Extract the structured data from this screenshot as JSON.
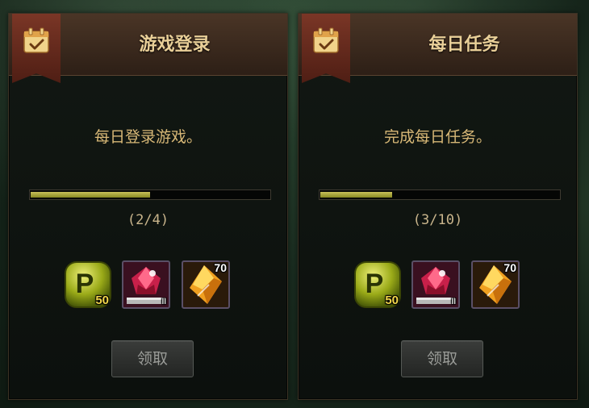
{
  "cards": [
    {
      "title": "游戏登录",
      "description": "每日登录游戏。",
      "progress_text": "(2/4)",
      "progress_fraction": 0.5,
      "rewards": [
        {
          "icon": "p-coin-icon",
          "amount": "50"
        },
        {
          "icon": "red-gem-box-icon",
          "tier": "II"
        },
        {
          "icon": "orange-crystal-icon",
          "count": "70"
        }
      ],
      "claim_label": "领取"
    },
    {
      "title": "每日任务",
      "description": "完成每日任务。",
      "progress_text": "(3/10)",
      "progress_fraction": 0.3,
      "rewards": [
        {
          "icon": "p-coin-icon",
          "amount": "50"
        },
        {
          "icon": "red-gem-box-icon",
          "tier": "II"
        },
        {
          "icon": "orange-crystal-icon",
          "count": "70"
        }
      ],
      "claim_label": "领取"
    }
  ],
  "colors": {
    "title": "#e9cf98",
    "description": "#d8b877",
    "progress_fill": "#b4ad3c",
    "badge": "#7a3626"
  }
}
